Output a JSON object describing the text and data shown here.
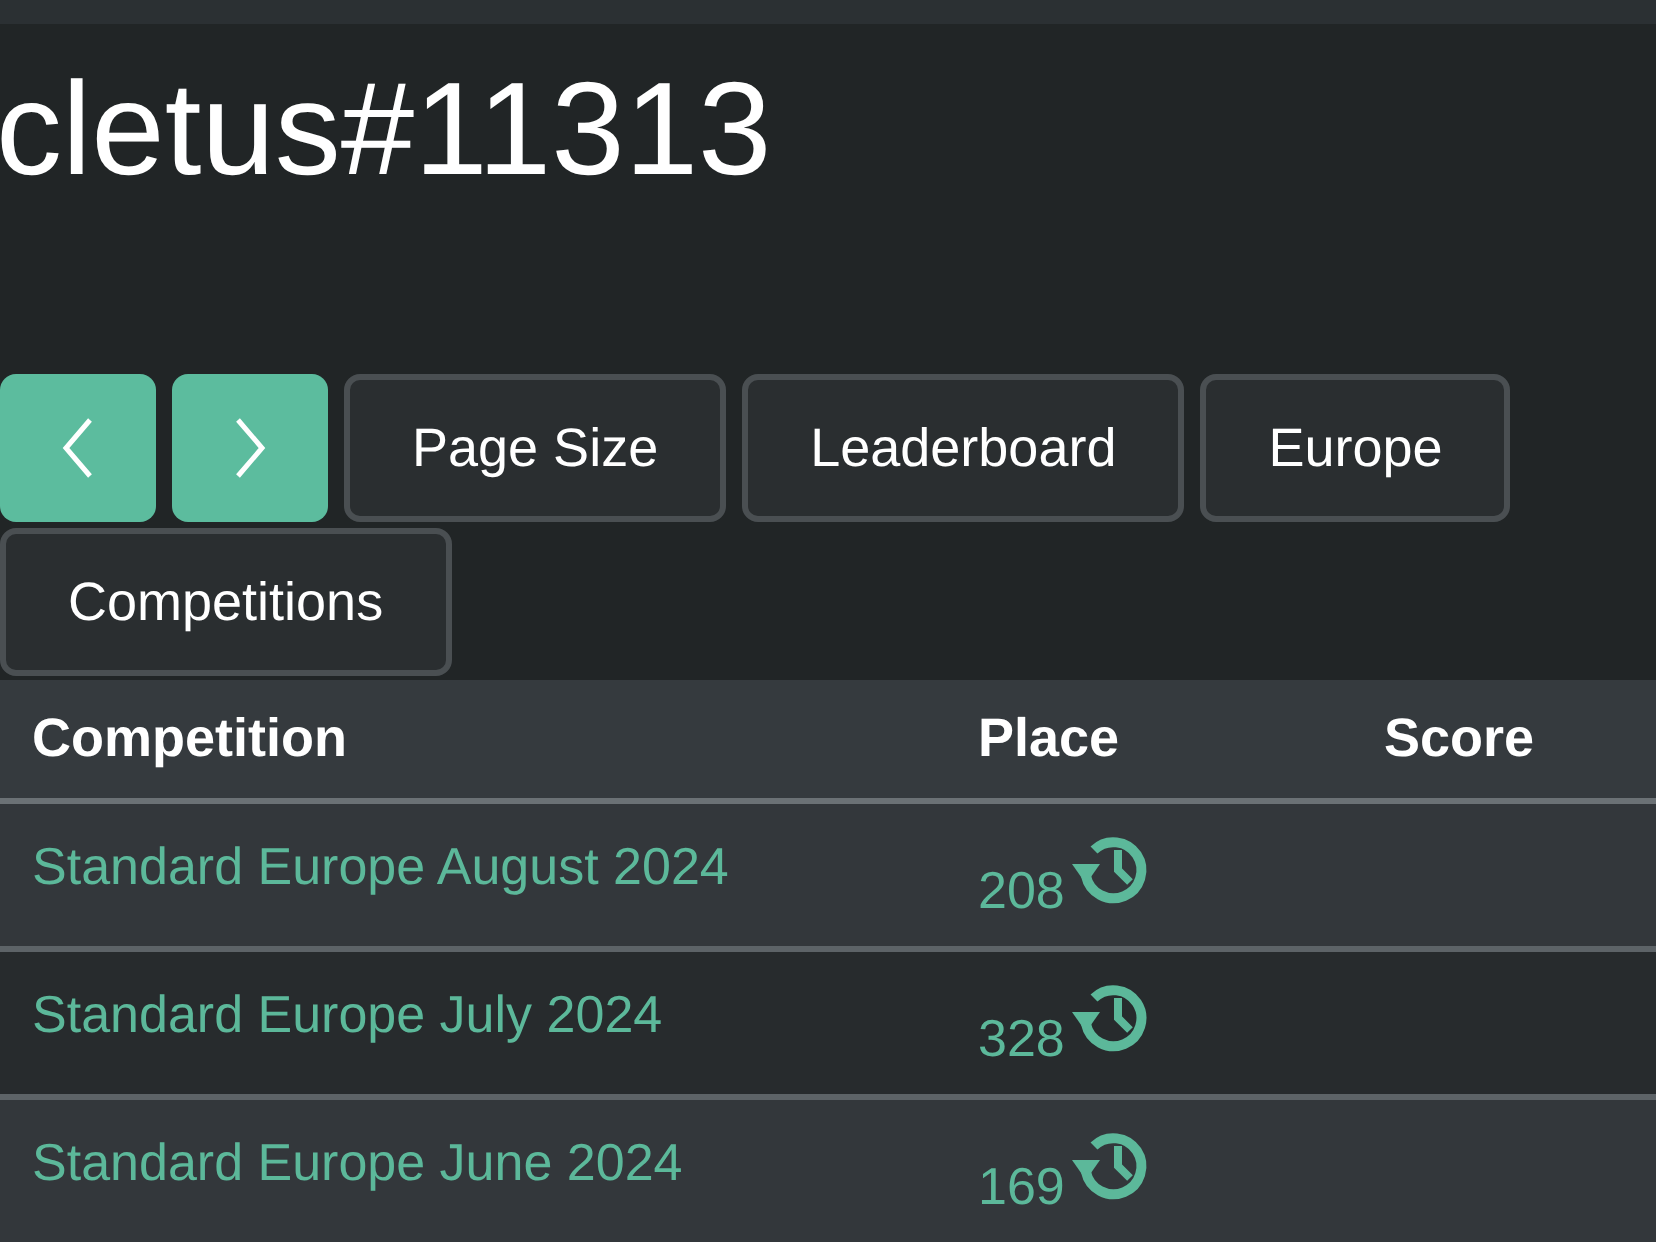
{
  "title": "cletus#11313",
  "toolbar": {
    "buttons": [
      {
        "kind": "prev"
      },
      {
        "kind": "next"
      },
      {
        "kind": "label",
        "label": "Page Size"
      },
      {
        "kind": "label",
        "label": "Leaderboard"
      },
      {
        "kind": "label",
        "label": "Europe"
      },
      {
        "kind": "label",
        "label": "Competitions"
      }
    ]
  },
  "table": {
    "columns": [
      "Competition",
      "Place",
      "Score"
    ],
    "rows": [
      {
        "competition": "Standard Europe August 2024",
        "place": "208"
      },
      {
        "competition": "Standard Europe July 2024",
        "place": "328"
      },
      {
        "competition": "Standard Europe June 2024",
        "place": "169"
      }
    ]
  }
}
